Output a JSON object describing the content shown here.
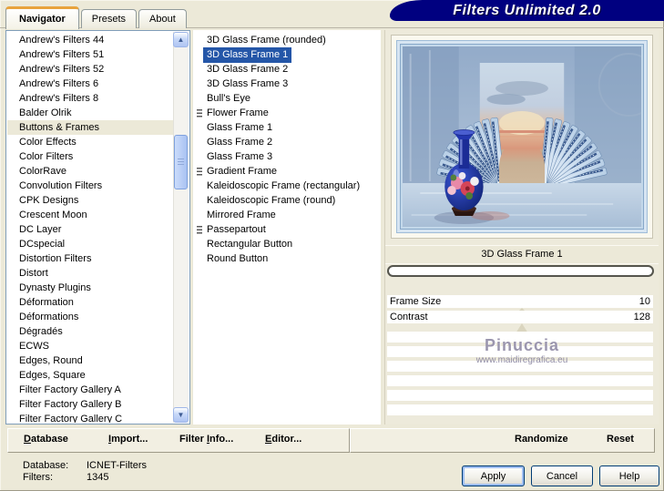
{
  "window": {
    "title": "Filters Unlimited 2.0"
  },
  "tabs": [
    {
      "label": "Navigator",
      "active": true
    },
    {
      "label": "Presets",
      "active": false
    },
    {
      "label": "About",
      "active": false
    }
  ],
  "category_list": {
    "selected_index": 6,
    "items": [
      "Andrew's Filters 44",
      "Andrew's Filters 51",
      "Andrew's Filters 52",
      "Andrew's Filters 6",
      "Andrew's Filters 8",
      "Balder Olrik",
      "Buttons & Frames",
      "Color Effects",
      "Color Filters",
      "ColorRave",
      "Convolution Filters",
      "CPK Designs",
      "Crescent Moon",
      "DC Layer",
      "DCspecial",
      "Distortion Filters",
      "Distort",
      "Dynasty Plugins",
      "Déformation",
      "Déformations",
      "Dégradés",
      "ECWS",
      "Edges, Round",
      "Edges, Square",
      "Filter Factory Gallery A",
      "Filter Factory Gallery B",
      "Filter Factory Gallery C"
    ]
  },
  "filter_list": {
    "items": [
      {
        "label": "3D Glass Frame (rounded)"
      },
      {
        "label": "3D Glass Frame 1",
        "selected": true
      },
      {
        "label": "3D Glass Frame 2"
      },
      {
        "label": "3D Glass Frame 3"
      },
      {
        "label": "Bull's Eye"
      },
      {
        "label": "Flower Frame",
        "icon": true
      },
      {
        "label": "Glass Frame 1"
      },
      {
        "label": "Glass Frame 2"
      },
      {
        "label": "Glass Frame 3"
      },
      {
        "label": "Gradient Frame",
        "icon": true
      },
      {
        "label": "Kaleidoscopic Frame (rectangular)"
      },
      {
        "label": "Kaleidoscopic Frame (round)"
      },
      {
        "label": "Mirrored Frame"
      },
      {
        "label": "Passepartout",
        "icon": true
      },
      {
        "label": "Rectangular Button"
      },
      {
        "label": "Round Button"
      }
    ]
  },
  "preview": {
    "caption": "3D Glass Frame 1",
    "watermark_name": "Pinuccia",
    "watermark_url": "www.maidiregrafica.eu"
  },
  "sliders": [
    {
      "label": "Frame Size",
      "value": "10"
    },
    {
      "label": "Contrast",
      "value": "128"
    }
  ],
  "toolbar": [
    {
      "label": "Database",
      "accel": 0
    },
    {
      "label": "Import...",
      "accel": 0
    },
    {
      "label": "Filter Info...",
      "accel": 7
    },
    {
      "label": "Editor...",
      "accel": 0
    }
  ],
  "randomize_bar": {
    "randomize": "Randomize",
    "reset": "Reset"
  },
  "status": {
    "database_label": "Database:",
    "database_value": "ICNET-Filters",
    "filters_label": "Filters:",
    "filters_value": "1345"
  },
  "buttons": {
    "apply": "Apply",
    "cancel": "Cancel",
    "help": "Help"
  },
  "colors": {
    "dialog_bg": "#ECE9D8",
    "banner": "#000080",
    "selection": "#2456A8",
    "tab_accent": "#E8A33D",
    "category_highlight": "#ECE9D8"
  }
}
